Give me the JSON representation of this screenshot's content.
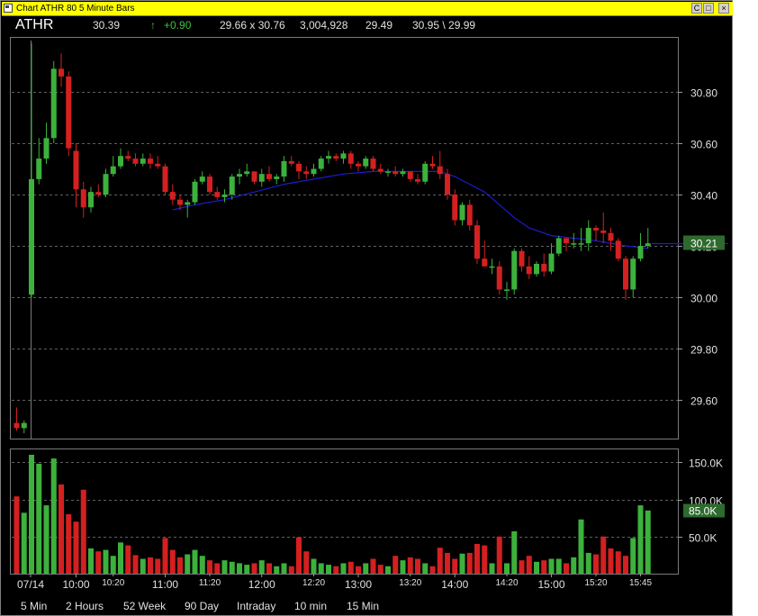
{
  "window": {
    "title": "Chart ATHR 80 5 Minute Bars",
    "controls": [
      "C",
      "□",
      "×"
    ]
  },
  "quote": {
    "symbol": "ATHR",
    "last": "30.39",
    "arrow": "↑",
    "change": "+0.90",
    "range": "29.66  x  30.76",
    "volume": "3,004,928",
    "open": "29.49",
    "hilo": "30.95 \\ 29.99"
  },
  "colors": {
    "up": "#3cb13c",
    "down": "#d42020",
    "ma": "#1c1cd0",
    "grid": "#606060",
    "axis_text": "#e0e0e0",
    "label_bg": "#2e6a2e"
  },
  "current_price_label": "30.21",
  "current_volume_label": "85.0K",
  "timeframes": [
    "5 Min",
    "2 Hours",
    "52 Week",
    "90 Day",
    "Intraday",
    "10 min",
    "15  Min"
  ],
  "chart_data": {
    "type": "candlestick",
    "price_axis": {
      "ylim": [
        29.45,
        31.0
      ],
      "ticks": [
        "30.80",
        "30.60",
        "30.40",
        "30.20",
        "30.00",
        "29.80",
        "29.60"
      ],
      "tick_values": [
        30.8,
        30.6,
        30.4,
        30.2,
        30.0,
        29.8,
        29.6
      ]
    },
    "volume_axis": {
      "ylim": [
        0,
        172
      ],
      "ticks": [
        "150.0K",
        "100.0K",
        "50.0K"
      ],
      "tick_values": [
        150,
        100,
        50
      ]
    },
    "x_labels_major": [
      "07/14",
      "10:00",
      "11:00",
      "12:00",
      "13:00",
      "14:00",
      "15:00"
    ],
    "x_labels_minor": [
      "10:20",
      "11:20",
      "12:20",
      "13:20",
      "14:20",
      "15:20",
      "15:45"
    ],
    "candles": [
      {
        "o": 29.51,
        "h": 29.57,
        "l": 29.48,
        "c": 29.49,
        "v": 104
      },
      {
        "o": 29.49,
        "h": 29.52,
        "l": 29.47,
        "c": 29.51,
        "v": 82
      },
      {
        "o": 30.01,
        "h": 30.99,
        "l": 30.0,
        "c": 30.46,
        "v": 160
      },
      {
        "o": 30.46,
        "h": 30.62,
        "l": 30.44,
        "c": 30.54,
        "v": 148
      },
      {
        "o": 30.54,
        "h": 30.68,
        "l": 30.52,
        "c": 30.62,
        "v": 92
      },
      {
        "o": 30.62,
        "h": 30.92,
        "l": 30.6,
        "c": 30.89,
        "v": 155
      },
      {
        "o": 30.89,
        "h": 30.95,
        "l": 30.82,
        "c": 30.86,
        "v": 120
      },
      {
        "o": 30.86,
        "h": 30.88,
        "l": 30.55,
        "c": 30.58,
        "v": 80
      },
      {
        "o": 30.57,
        "h": 30.6,
        "l": 30.35,
        "c": 30.42,
        "v": 70
      },
      {
        "o": 30.42,
        "h": 30.45,
        "l": 30.31,
        "c": 30.35,
        "v": 113
      },
      {
        "o": 30.35,
        "h": 30.43,
        "l": 30.33,
        "c": 30.41,
        "v": 34
      },
      {
        "o": 30.41,
        "h": 30.44,
        "l": 30.39,
        "c": 30.4,
        "v": 30
      },
      {
        "o": 30.4,
        "h": 30.5,
        "l": 30.39,
        "c": 30.48,
        "v": 32
      },
      {
        "o": 30.48,
        "h": 30.55,
        "l": 30.47,
        "c": 30.51,
        "v": 24
      },
      {
        "o": 30.51,
        "h": 30.58,
        "l": 30.5,
        "c": 30.55,
        "v": 42
      },
      {
        "o": 30.55,
        "h": 30.57,
        "l": 30.53,
        "c": 30.54,
        "v": 38
      },
      {
        "o": 30.54,
        "h": 30.56,
        "l": 30.51,
        "c": 30.52,
        "v": 25
      },
      {
        "o": 30.52,
        "h": 30.56,
        "l": 30.51,
        "c": 30.54,
        "v": 20
      },
      {
        "o": 30.54,
        "h": 30.56,
        "l": 30.5,
        "c": 30.52,
        "v": 22
      },
      {
        "o": 30.52,
        "h": 30.55,
        "l": 30.5,
        "c": 30.51,
        "v": 20
      },
      {
        "o": 30.51,
        "h": 30.52,
        "l": 30.4,
        "c": 30.41,
        "v": 48
      },
      {
        "o": 30.41,
        "h": 30.44,
        "l": 30.36,
        "c": 30.38,
        "v": 32
      },
      {
        "o": 30.38,
        "h": 30.4,
        "l": 30.34,
        "c": 30.36,
        "v": 22
      },
      {
        "o": 30.36,
        "h": 30.38,
        "l": 30.31,
        "c": 30.37,
        "v": 26
      },
      {
        "o": 30.37,
        "h": 30.46,
        "l": 30.36,
        "c": 30.45,
        "v": 32
      },
      {
        "o": 30.45,
        "h": 30.49,
        "l": 30.44,
        "c": 30.47,
        "v": 24
      },
      {
        "o": 30.47,
        "h": 30.48,
        "l": 30.4,
        "c": 30.41,
        "v": 18
      },
      {
        "o": 30.41,
        "h": 30.43,
        "l": 30.38,
        "c": 30.39,
        "v": 14
      },
      {
        "o": 30.39,
        "h": 30.42,
        "l": 30.37,
        "c": 30.4,
        "v": 18
      },
      {
        "o": 30.4,
        "h": 30.48,
        "l": 30.38,
        "c": 30.47,
        "v": 16
      },
      {
        "o": 30.47,
        "h": 30.5,
        "l": 30.44,
        "c": 30.48,
        "v": 14
      },
      {
        "o": 30.48,
        "h": 30.52,
        "l": 30.47,
        "c": 30.49,
        "v": 12
      },
      {
        "o": 30.49,
        "h": 30.49,
        "l": 30.44,
        "c": 30.45,
        "v": 14
      },
      {
        "o": 30.45,
        "h": 30.5,
        "l": 30.43,
        "c": 30.48,
        "v": 18
      },
      {
        "o": 30.48,
        "h": 30.51,
        "l": 30.45,
        "c": 30.46,
        "v": 14
      },
      {
        "o": 30.46,
        "h": 30.48,
        "l": 30.44,
        "c": 30.47,
        "v": 10
      },
      {
        "o": 30.47,
        "h": 30.55,
        "l": 30.45,
        "c": 30.53,
        "v": 14
      },
      {
        "o": 30.53,
        "h": 30.55,
        "l": 30.51,
        "c": 30.52,
        "v": 10
      },
      {
        "o": 30.52,
        "h": 30.53,
        "l": 30.46,
        "c": 30.49,
        "v": 49
      },
      {
        "o": 30.49,
        "h": 30.51,
        "l": 30.46,
        "c": 30.48,
        "v": 30
      },
      {
        "o": 30.48,
        "h": 30.52,
        "l": 30.47,
        "c": 30.5,
        "v": 20
      },
      {
        "o": 30.5,
        "h": 30.55,
        "l": 30.49,
        "c": 30.54,
        "v": 14
      },
      {
        "o": 30.54,
        "h": 30.57,
        "l": 30.52,
        "c": 30.55,
        "v": 12
      },
      {
        "o": 30.55,
        "h": 30.56,
        "l": 30.53,
        "c": 30.54,
        "v": 10
      },
      {
        "o": 30.54,
        "h": 30.57,
        "l": 30.52,
        "c": 30.56,
        "v": 14
      },
      {
        "o": 30.56,
        "h": 30.57,
        "l": 30.5,
        "c": 30.52,
        "v": 16
      },
      {
        "o": 30.52,
        "h": 30.53,
        "l": 30.49,
        "c": 30.51,
        "v": 10
      },
      {
        "o": 30.51,
        "h": 30.55,
        "l": 30.5,
        "c": 30.54,
        "v": 14
      },
      {
        "o": 30.54,
        "h": 30.55,
        "l": 30.49,
        "c": 30.5,
        "v": 20
      },
      {
        "o": 30.5,
        "h": 30.52,
        "l": 30.48,
        "c": 30.49,
        "v": 12
      },
      {
        "o": 30.49,
        "h": 30.5,
        "l": 30.47,
        "c": 30.49,
        "v": 10
      },
      {
        "o": 30.49,
        "h": 30.51,
        "l": 30.47,
        "c": 30.48,
        "v": 24
      },
      {
        "o": 30.48,
        "h": 30.5,
        "l": 30.47,
        "c": 30.49,
        "v": 18
      },
      {
        "o": 30.49,
        "h": 30.49,
        "l": 30.45,
        "c": 30.46,
        "v": 22
      },
      {
        "o": 30.46,
        "h": 30.48,
        "l": 30.44,
        "c": 30.45,
        "v": 20
      },
      {
        "o": 30.45,
        "h": 30.53,
        "l": 30.44,
        "c": 30.52,
        "v": 14
      },
      {
        "o": 30.52,
        "h": 30.55,
        "l": 30.5,
        "c": 30.51,
        "v": 10
      },
      {
        "o": 30.51,
        "h": 30.57,
        "l": 30.46,
        "c": 30.48,
        "v": 35
      },
      {
        "o": 30.48,
        "h": 30.5,
        "l": 30.38,
        "c": 30.4,
        "v": 28
      },
      {
        "o": 30.4,
        "h": 30.42,
        "l": 30.28,
        "c": 30.3,
        "v": 20
      },
      {
        "o": 30.3,
        "h": 30.37,
        "l": 30.28,
        "c": 30.36,
        "v": 27
      },
      {
        "o": 30.36,
        "h": 30.38,
        "l": 30.26,
        "c": 30.28,
        "v": 28
      },
      {
        "o": 30.28,
        "h": 30.3,
        "l": 30.13,
        "c": 30.15,
        "v": 40
      },
      {
        "o": 30.15,
        "h": 30.22,
        "l": 30.12,
        "c": 30.12,
        "v": 38
      },
      {
        "o": 30.12,
        "h": 30.15,
        "l": 30.09,
        "c": 30.12,
        "v": 14
      },
      {
        "o": 30.12,
        "h": 30.14,
        "l": 30.01,
        "c": 30.03,
        "v": 50
      },
      {
        "o": 30.03,
        "h": 30.06,
        "l": 29.99,
        "c": 30.03,
        "v": 14
      },
      {
        "o": 30.03,
        "h": 30.19,
        "l": 30.01,
        "c": 30.18,
        "v": 57
      },
      {
        "o": 30.18,
        "h": 30.19,
        "l": 30.1,
        "c": 30.12,
        "v": 18
      },
      {
        "o": 30.12,
        "h": 30.16,
        "l": 30.07,
        "c": 30.09,
        "v": 24
      },
      {
        "o": 30.09,
        "h": 30.14,
        "l": 30.08,
        "c": 30.13,
        "v": 16
      },
      {
        "o": 30.13,
        "h": 30.17,
        "l": 30.08,
        "c": 30.1,
        "v": 18
      },
      {
        "o": 30.1,
        "h": 30.21,
        "l": 30.09,
        "c": 30.17,
        "v": 20
      },
      {
        "o": 30.17,
        "h": 30.24,
        "l": 30.16,
        "c": 30.23,
        "v": 20
      },
      {
        "o": 30.23,
        "h": 30.23,
        "l": 30.18,
        "c": 30.21,
        "v": 14
      },
      {
        "o": 30.21,
        "h": 30.25,
        "l": 30.19,
        "c": 30.21,
        "v": 22
      },
      {
        "o": 30.21,
        "h": 30.27,
        "l": 30.18,
        "c": 30.21,
        "v": 73
      },
      {
        "o": 30.21,
        "h": 30.3,
        "l": 30.18,
        "c": 30.27,
        "v": 28
      },
      {
        "o": 30.27,
        "h": 30.28,
        "l": 30.22,
        "c": 30.26,
        "v": 26
      },
      {
        "o": 30.26,
        "h": 30.33,
        "l": 30.21,
        "c": 30.25,
        "v": 50
      },
      {
        "o": 30.25,
        "h": 30.27,
        "l": 30.18,
        "c": 30.22,
        "v": 34
      },
      {
        "o": 30.22,
        "h": 30.23,
        "l": 30.14,
        "c": 30.15,
        "v": 30
      },
      {
        "o": 30.15,
        "h": 30.16,
        "l": 29.99,
        "c": 30.03,
        "v": 24
      },
      {
        "o": 30.03,
        "h": 30.16,
        "l": 30.0,
        "c": 30.15,
        "v": 48
      },
      {
        "o": 30.15,
        "h": 30.25,
        "l": 30.14,
        "c": 30.2,
        "v": 92
      },
      {
        "o": 30.2,
        "h": 30.27,
        "l": 30.19,
        "c": 30.21,
        "v": 85
      }
    ],
    "moving_average": [
      {
        "i": 21,
        "v": 30.34
      },
      {
        "i": 24,
        "v": 30.36
      },
      {
        "i": 28,
        "v": 30.38
      },
      {
        "i": 32,
        "v": 30.41
      },
      {
        "i": 36,
        "v": 30.44
      },
      {
        "i": 40,
        "v": 30.46
      },
      {
        "i": 44,
        "v": 30.48
      },
      {
        "i": 48,
        "v": 30.49
      },
      {
        "i": 52,
        "v": 30.49
      },
      {
        "i": 55,
        "v": 30.49
      },
      {
        "i": 57,
        "v": 30.49
      },
      {
        "i": 59,
        "v": 30.47
      },
      {
        "i": 61,
        "v": 30.44
      },
      {
        "i": 63,
        "v": 30.41
      },
      {
        "i": 65,
        "v": 30.36
      },
      {
        "i": 67,
        "v": 30.31
      },
      {
        "i": 69,
        "v": 30.27
      },
      {
        "i": 72,
        "v": 30.24
      },
      {
        "i": 75,
        "v": 30.23
      },
      {
        "i": 78,
        "v": 30.22
      },
      {
        "i": 82,
        "v": 30.2
      },
      {
        "i": 85,
        "v": 30.19
      }
    ]
  }
}
